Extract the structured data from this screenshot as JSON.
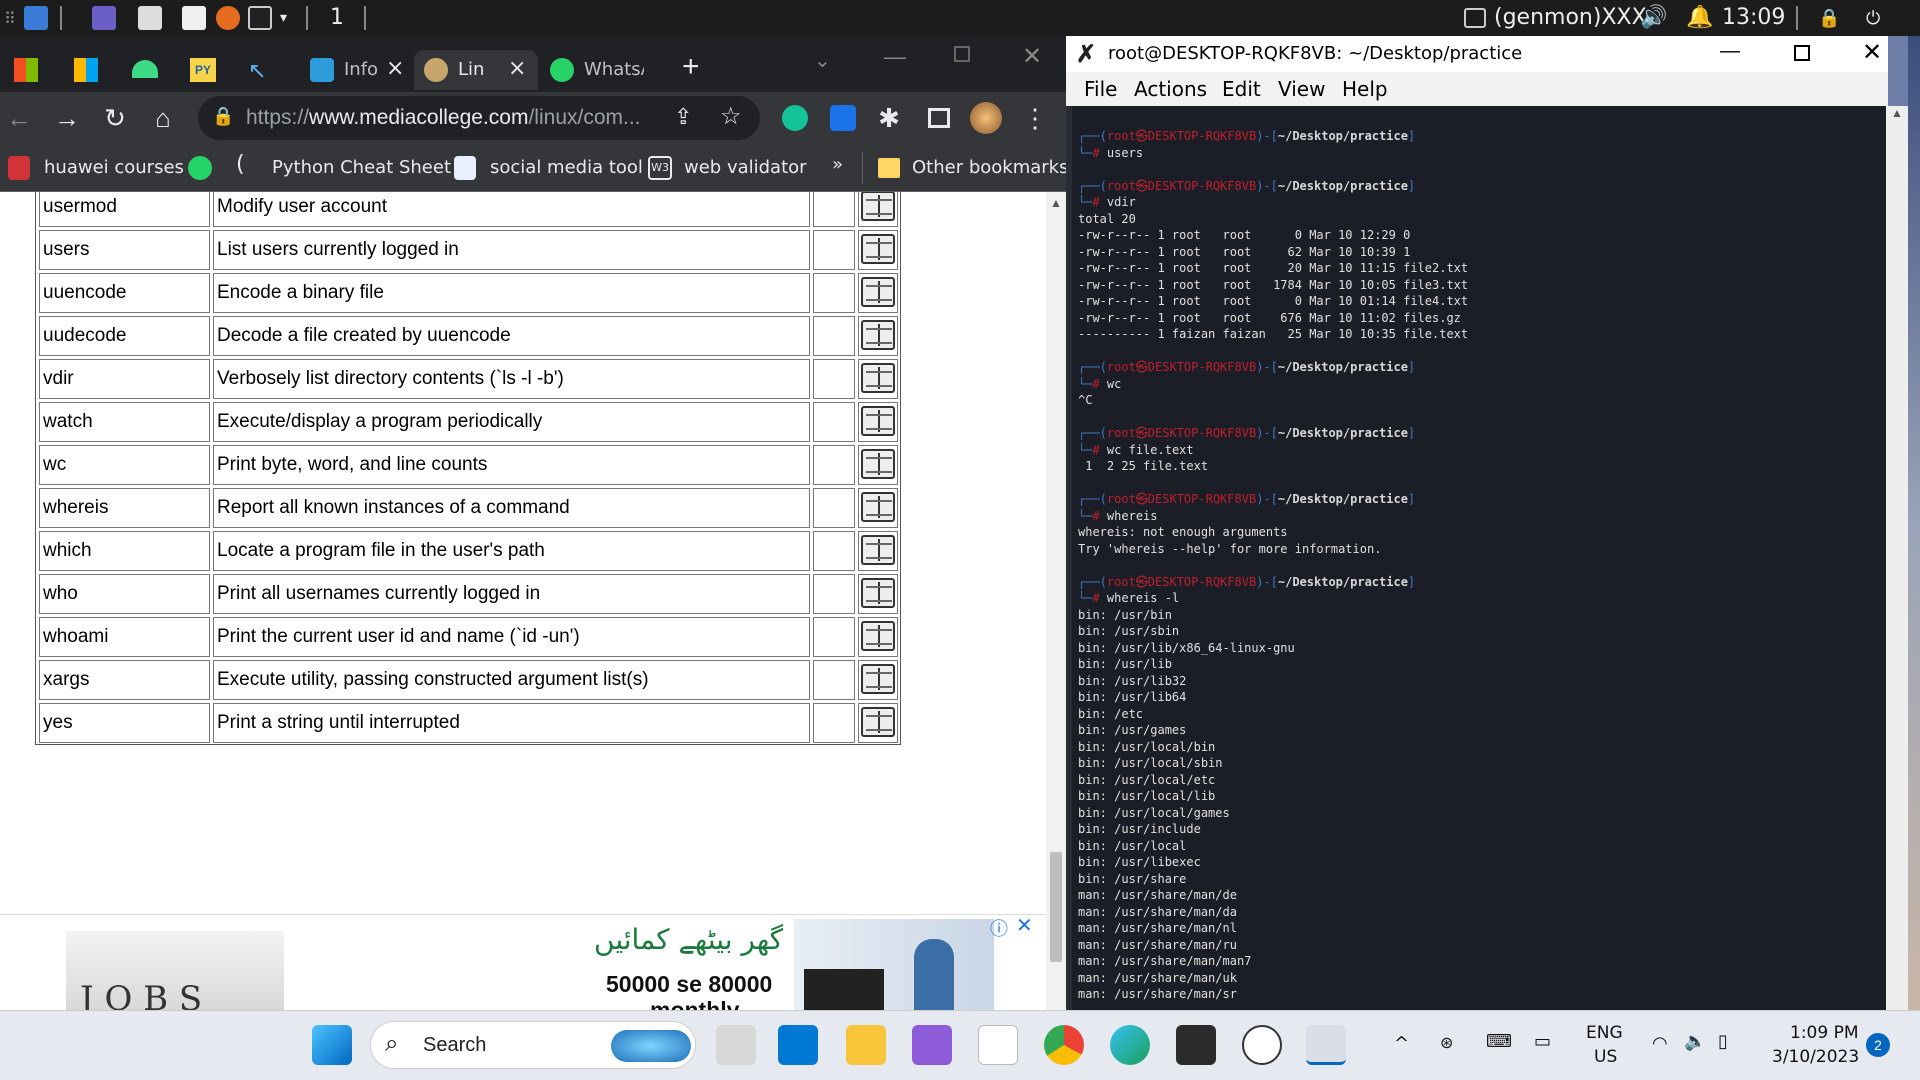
{
  "top_panel": {
    "workspace": "1",
    "genmon": "(genmon)XXX",
    "clock": "13:09"
  },
  "chrome": {
    "tabs": [
      {
        "label": "Info",
        "icon": "tab-info-icon"
      },
      {
        "label": "Linux",
        "icon": "tab-linux-icon"
      },
      {
        "label": "WhatsApp",
        "icon": "whatsapp-icon"
      }
    ],
    "url_prefix": "https://",
    "url_host": "www.mediacollege.com",
    "url_path": "/linux/com...",
    "bookmarks": [
      "huawei courses",
      "",
      "Python Cheat Sheet",
      "social media tool",
      "web validator"
    ],
    "bookmarks_more": "»",
    "other_bookmarks": "Other bookmarks"
  },
  "commands": [
    {
      "name": "usermod",
      "desc": "Modify user account"
    },
    {
      "name": "users",
      "desc": "List users currently logged in"
    },
    {
      "name": "uuencode",
      "desc": "Encode a binary file"
    },
    {
      "name": "uudecode",
      "desc": "Decode a file created by uuencode"
    },
    {
      "name": "vdir",
      "desc": "Verbosely list directory contents (`ls -l -b')"
    },
    {
      "name": "watch",
      "desc": "Execute/display a program periodically"
    },
    {
      "name": "wc",
      "desc": "Print byte, word, and line counts"
    },
    {
      "name": "whereis",
      "desc": "Report all known instances of a command"
    },
    {
      "name": "which",
      "desc": "Locate a program file in the user's path"
    },
    {
      "name": "who",
      "desc": "Print all usernames currently logged in"
    },
    {
      "name": "whoami",
      "desc": "Print the current user id and name (`id -un')"
    },
    {
      "name": "xargs",
      "desc": "Execute utility, passing constructed argument list(s)"
    },
    {
      "name": "yes",
      "desc": "Print a string until interrupted"
    }
  ],
  "ad": {
    "urdu": "گھر بیٹھے کمائیں",
    "line1": "50000 se 80000",
    "line2": "monthly",
    "jobs": "J O B S"
  },
  "terminal": {
    "title": "root@DESKTOP-RQKF8VB: ~/Desktop/practice",
    "menu": [
      "File",
      "Actions",
      "Edit",
      "View",
      "Help"
    ],
    "prompt_user": "root㉿DESKTOP-RQKF8VB",
    "prompt_path": "~/Desktop/practice",
    "blocks": [
      {
        "cmd": "users",
        "output": []
      },
      {
        "cmd": "vdir",
        "output": [
          "total 20",
          "-rw-r--r-- 1 root   root      0 Mar 10 12:29 0",
          "-rw-r--r-- 1 root   root     62 Mar 10 10:39 1",
          "-rw-r--r-- 1 root   root     20 Mar 10 11:15 file2.txt",
          "-rw-r--r-- 1 root   root   1784 Mar 10 10:05 file3.txt",
          "-rw-r--r-- 1 root   root      0 Mar 10 01:14 file4.txt",
          "-rw-r--r-- 1 root   root    676 Mar 10 11:02 files.gz",
          "---------- 1 faizan faizan   25 Mar 10 10:35 file.text"
        ]
      },
      {
        "cmd": "wc",
        "output": [
          "^C"
        ]
      },
      {
        "cmd": "wc file.text",
        "output": [
          " 1  2 25 file.text"
        ]
      },
      {
        "cmd": "whereis",
        "output": [
          "whereis: not enough arguments",
          "Try 'whereis --help' for more information."
        ]
      },
      {
        "cmd": "whereis -l",
        "output": [
          "bin: /usr/bin",
          "bin: /usr/sbin",
          "bin: /usr/lib/x86_64-linux-gnu",
          "bin: /usr/lib",
          "bin: /usr/lib32",
          "bin: /usr/lib64",
          "bin: /etc",
          "bin: /usr/games",
          "bin: /usr/local/bin",
          "bin: /usr/local/sbin",
          "bin: /usr/local/etc",
          "bin: /usr/local/lib",
          "bin: /usr/local/games",
          "bin: /usr/include",
          "bin: /usr/local",
          "bin: /usr/libexec",
          "bin: /usr/share",
          "man: /usr/share/man/de",
          "man: /usr/share/man/da",
          "man: /usr/share/man/nl",
          "man: /usr/share/man/ru",
          "man: /usr/share/man/man7",
          "man: /usr/share/man/uk",
          "man: /usr/share/man/sr"
        ]
      }
    ]
  },
  "taskbar": {
    "search": "Search",
    "lang1": "ENG",
    "lang2": "US",
    "time": "1:09 PM",
    "date": "3/10/2023",
    "notifications": "2"
  }
}
